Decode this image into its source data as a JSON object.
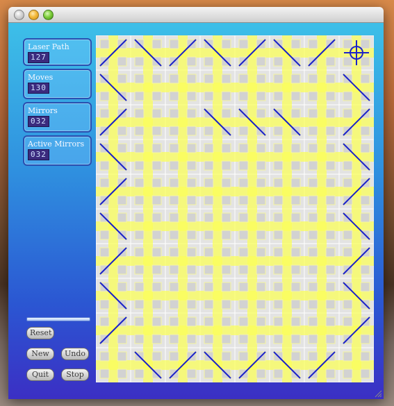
{
  "window": {
    "title": ""
  },
  "stats": [
    {
      "label": "Laser Path",
      "value": "127"
    },
    {
      "label": "Moves",
      "value": "130"
    },
    {
      "label": "Mirrors",
      "value": "032"
    },
    {
      "label": "Active Mirrors",
      "value": "032"
    }
  ],
  "buttons": {
    "reset": "Reset",
    "new": "New",
    "undo": "Undo",
    "quit": "Quit",
    "stop": "Stop"
  },
  "slider": {
    "value": 0
  },
  "board": {
    "cols": 8,
    "rows": 10,
    "colors": {
      "mirror": "#1b22c9",
      "laser": "#fbff5a",
      "cell": "#e3e3e3",
      "grid": "#ffffff",
      "target": "#1b22c9"
    },
    "mirrors": [
      {
        "c": 0,
        "r": 0,
        "d": "/"
      },
      {
        "c": 1,
        "r": 0,
        "d": "\\"
      },
      {
        "c": 2,
        "r": 0,
        "d": "/"
      },
      {
        "c": 3,
        "r": 0,
        "d": "\\"
      },
      {
        "c": 4,
        "r": 0,
        "d": "/"
      },
      {
        "c": 5,
        "r": 0,
        "d": "\\"
      },
      {
        "c": 6,
        "r": 0,
        "d": "/"
      },
      {
        "c": 0,
        "r": 1,
        "d": "\\"
      },
      {
        "c": 7,
        "r": 1,
        "d": "\\"
      },
      {
        "c": 0,
        "r": 2,
        "d": "/"
      },
      {
        "c": 3,
        "r": 2,
        "d": "\\"
      },
      {
        "c": 4,
        "r": 2,
        "d": "\\"
      },
      {
        "c": 5,
        "r": 2,
        "d": "\\"
      },
      {
        "c": 7,
        "r": 2,
        "d": "/"
      },
      {
        "c": 0,
        "r": 3,
        "d": "\\"
      },
      {
        "c": 7,
        "r": 3,
        "d": "\\"
      },
      {
        "c": 0,
        "r": 4,
        "d": "/"
      },
      {
        "c": 7,
        "r": 4,
        "d": "/"
      },
      {
        "c": 0,
        "r": 5,
        "d": "\\"
      },
      {
        "c": 7,
        "r": 5,
        "d": "\\"
      },
      {
        "c": 0,
        "r": 6,
        "d": "/"
      },
      {
        "c": 7,
        "r": 6,
        "d": "/"
      },
      {
        "c": 0,
        "r": 7,
        "d": "\\"
      },
      {
        "c": 7,
        "r": 7,
        "d": "\\"
      },
      {
        "c": 0,
        "r": 8,
        "d": "/"
      },
      {
        "c": 7,
        "r": 8,
        "d": "/"
      },
      {
        "c": 1,
        "r": 9,
        "d": "\\"
      },
      {
        "c": 2,
        "r": 9,
        "d": "/"
      },
      {
        "c": 3,
        "r": 9,
        "d": "\\"
      },
      {
        "c": 4,
        "r": 9,
        "d": "/"
      },
      {
        "c": 5,
        "r": 9,
        "d": "\\"
      },
      {
        "c": 6,
        "r": 9,
        "d": "/"
      }
    ],
    "target": {
      "c": 7,
      "r": 0
    }
  }
}
